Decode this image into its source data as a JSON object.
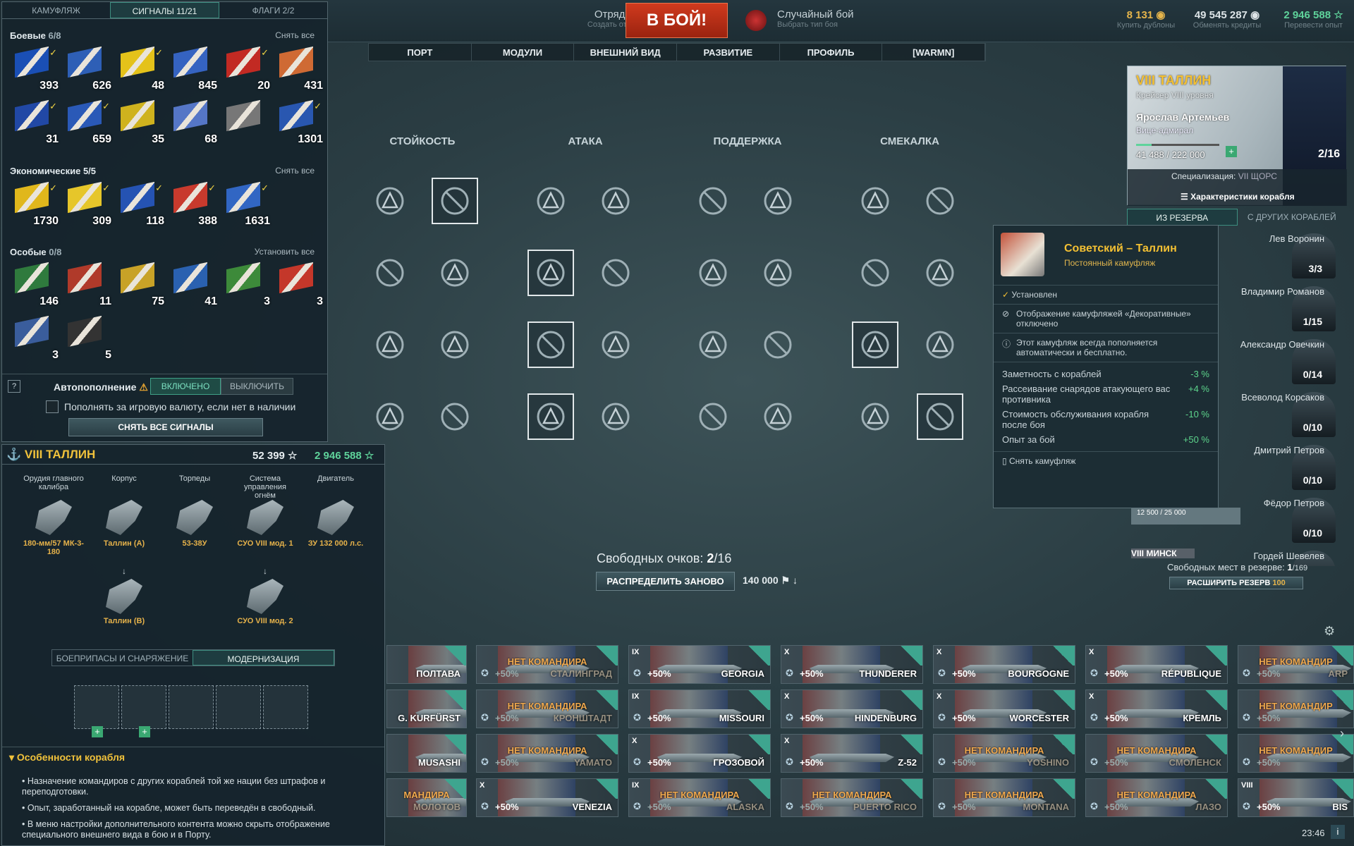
{
  "flags_panel": {
    "tabs": [
      "КАМУФЛЯЖ",
      "СИГНАЛЫ 11/21",
      "ФЛАГИ 2/2"
    ],
    "combat": {
      "title": "Боевые",
      "count": "6/8",
      "action": "Снять все",
      "items": [
        {
          "n": "393",
          "on": true,
          "c": "#1a4fb5"
        },
        {
          "n": "626",
          "on": false,
          "c": "#2e5fb6"
        },
        {
          "n": "48",
          "on": true,
          "c": "#e4c21a"
        },
        {
          "n": "845",
          "on": false,
          "c": "#3563c1"
        },
        {
          "n": "20",
          "on": true,
          "c": "#c22a23"
        },
        {
          "n": "431",
          "on": false,
          "c": "#cf6a34"
        },
        {
          "n": "31",
          "on": true,
          "c": "#2148a5"
        },
        {
          "n": "659",
          "on": true,
          "c": "#2a59b7"
        },
        {
          "n": "35",
          "on": false,
          "c": "#cfb21e"
        },
        {
          "n": "68",
          "on": false,
          "c": "#5576c6"
        },
        {
          "n": "",
          "on": false,
          "c": "#777"
        },
        {
          "n": "1301",
          "on": true,
          "c": "#2957b0"
        }
      ]
    },
    "economic": {
      "title": "Экономические",
      "count": "5/5",
      "action": "Снять все",
      "items": [
        {
          "n": "1730",
          "on": true,
          "c": "#e0b71c"
        },
        {
          "n": "309",
          "on": true,
          "c": "#e6c62a"
        },
        {
          "n": "118",
          "on": true,
          "c": "#2553b3"
        },
        {
          "n": "388",
          "on": true,
          "c": "#c83a2d"
        },
        {
          "n": "1631",
          "on": true,
          "c": "#3166c3"
        }
      ]
    },
    "special": {
      "title": "Особые",
      "count": "0/8",
      "action": "Установить все",
      "items": [
        {
          "n": "146",
          "c": "#2f7a3d"
        },
        {
          "n": "11",
          "c": "#b03a2a"
        },
        {
          "n": "75",
          "c": "#c8a227"
        },
        {
          "n": "41",
          "c": "#2a61b0"
        },
        {
          "n": "3",
          "c": "#3d8a3a"
        },
        {
          "n": "3",
          "c": "#c4372a"
        },
        {
          "n": "3",
          "c": "#3a5d9c"
        },
        {
          "n": "5",
          "c": "#333"
        }
      ]
    },
    "autofill": {
      "label": "Автопополнение",
      "on": "ВКЛЮЧЕНО",
      "off": "ВЫКЛЮЧИТЬ",
      "checkbox": "Пополнять за игровую валюту, если нет в наличии",
      "remove_all": "СНЯТЬ ВСЕ СИГНАЛЫ",
      "help": "?"
    }
  },
  "ship_panel": {
    "title": "VIII ТАЛЛИН",
    "xp": "52 399",
    "free_xp": "2 946 588",
    "modules": [
      {
        "label": "Орудия главного калибра",
        "name": "180-мм/57 МК-3-180"
      },
      {
        "label": "Корпус",
        "name": "Таллин (A)"
      },
      {
        "label": "Торпеды",
        "name": "53-38У"
      },
      {
        "label": "Система управления огнём",
        "name": "СУО VIII мод. 1"
      },
      {
        "label": "Двигатель",
        "name": "ЗУ 132 000 л.с."
      }
    ],
    "upgrades": [
      {
        "name": "Таллин (B)"
      },
      {
        "name": "СУО VIII мод. 2"
      }
    ],
    "tabs": [
      "БОЕПРИПАСЫ И СНАРЯЖЕНИЕ",
      "МОДЕРНИЗАЦИЯ"
    ],
    "features_title": "Особенности корабля",
    "features": [
      "Назначение командиров с других кораблей той же нации без штрафов и переподготовки.",
      "Опыт, заработанный на корабле, может быть переведён в свободный.",
      "В меню настройки дополнительного контента можно скрыть отображение специального внешнего вида в бою и в Порту."
    ]
  },
  "top": {
    "squad": "Отряды",
    "squad_sub": "Создать отряд",
    "battle": "В БОЙ!",
    "mode": "Случайный бой",
    "mode_sub": "Выбрать тип боя",
    "doubloons": "8 131",
    "doubloons_sub": "Купить дублоны",
    "credits": "49 545 287",
    "credits_sub": "Обменять кредиты",
    "freexp": "2 946 588",
    "freexp_sub": "Перевести опыт"
  },
  "nav": [
    "ПОРТ",
    "МОДУЛИ",
    "ВНЕШНИЙ ВИД",
    "РАЗВИТИЕ",
    "ПРОФИЛЬ",
    "[WARMN]"
  ],
  "skills": {
    "columns": [
      "СТОЙКОСТЬ",
      "АТАКА",
      "ПОДДЕРЖКА",
      "СМЕКАЛКА"
    ],
    "free_label": "Свободных очков:",
    "free": "2",
    "total": "/16",
    "reset": "РАСПРЕДЕЛИТЬ ЗАНОВО",
    "reset_cost": "140 000"
  },
  "commander": {
    "ship": "VIII ТАЛЛИН",
    "ship_sub": "Крейсер VIII уровня",
    "name": "Ярослав Артемьев",
    "rank": "Вице-адмирал",
    "xp": "41 488 / 222 000",
    "pts": "2/16",
    "spec_label": "Специализация:",
    "spec": "VII ЩОРС",
    "chars": "Характеристики корабля",
    "tabs": [
      "ИЗ РЕЗЕРВА",
      "С ДРУГИХ КОРАБЛЕЙ"
    ],
    "reserve": [
      {
        "name": "Лев Воронин",
        "pts": "3/3"
      },
      {
        "name": "Владимир Романов",
        "pts": "1/15"
      },
      {
        "name": "Александр Овечкин",
        "pts": "0/14"
      },
      {
        "name": "Всеволод Корсаков",
        "pts": "0/10"
      },
      {
        "name": "Дмитрий Петров",
        "pts": "0/10"
      },
      {
        "name": "Фёдор Петров",
        "pts": "0/10"
      },
      {
        "name": "Гордей Шевелев",
        "pts": ""
      }
    ],
    "minsk": "VIII МИНСК",
    "minsk_xp": "12 500 / 25 000",
    "slots_label": "Свободных мест в резерве:",
    "slots": "1",
    "slots_total": "/169",
    "expand": "РАСШИРИТЬ РЕЗЕРВ",
    "expand_cost": "100"
  },
  "tooltip": {
    "title": "Советский – Таллин",
    "sub": "Постоянный камуфляж",
    "installed": "Установлен",
    "note1": "Отображение камуфляжей «Декоративные» отключено",
    "note2": "Этот камуфляж всегда пополняется автоматически и бесплатно.",
    "stats": [
      {
        "l": "Заметность с кораблей",
        "v": "-3 %"
      },
      {
        "l": "Рассеивание снарядов атакующего вас противника",
        "v": "+4 %"
      },
      {
        "l": "Стоимость обслуживания корабля после боя",
        "v": "-10 %"
      },
      {
        "l": "Опыт за бой",
        "v": "+50 %"
      }
    ],
    "remove": "Снять камуфляж"
  },
  "carousel": {
    "rows": [
      [
        {
          "nc": "",
          "n": "ПОЛТАВА",
          "xp": "",
          "t": ""
        },
        {
          "nc": "НЕТ КОМАНДИРА",
          "n": "СТАЛИНГРАД",
          "xp": "+50%",
          "t": "",
          "dim": true
        },
        {
          "nc": "",
          "n": "GEORGIA",
          "xp": "+50%",
          "t": "IX"
        },
        {
          "nc": "",
          "n": "THUNDERER",
          "xp": "+50%",
          "t": "X"
        },
        {
          "nc": "",
          "n": "BOURGOGNE",
          "xp": "+50%",
          "t": "X"
        },
        {
          "nc": "",
          "n": "RÉPUBLIQUE",
          "xp": "+50%",
          "t": "X"
        },
        {
          "nc": "НЕТ КОМАНДИР",
          "n": "ARP",
          "xp": "+50%",
          "t": "",
          "dim": true
        }
      ],
      [
        {
          "nc": "",
          "n": "G. KURFÜRST",
          "xp": "",
          "t": ""
        },
        {
          "nc": "НЕТ КОМАНДИРА",
          "n": "КРОНШТАДТ",
          "xp": "+50%",
          "t": "",
          "dim": true
        },
        {
          "nc": "",
          "n": "MISSOURI",
          "xp": "+50%",
          "t": "IX"
        },
        {
          "nc": "",
          "n": "HINDENBURG",
          "xp": "+50%",
          "t": "X"
        },
        {
          "nc": "",
          "n": "WORCESTER",
          "xp": "+50%",
          "t": "X"
        },
        {
          "nc": "",
          "n": "КРЕМЛЬ",
          "xp": "+50%",
          "t": "X"
        },
        {
          "nc": "НЕТ КОМАНДИР",
          "n": "",
          "xp": "+50%",
          "t": "",
          "dim": true
        }
      ],
      [
        {
          "nc": "",
          "n": "MUSASHI",
          "xp": "",
          "t": ""
        },
        {
          "nc": "НЕТ КОМАНДИРА",
          "n": "YAMATO",
          "xp": "+50%",
          "t": "",
          "dim": true
        },
        {
          "nc": "",
          "n": "ГРОЗОВОЙ",
          "xp": "+50%",
          "t": "X"
        },
        {
          "nc": "",
          "n": "Z-52",
          "xp": "+50%",
          "t": "X"
        },
        {
          "nc": "НЕТ КОМАНДИРА",
          "n": "YOSHINO",
          "xp": "+50%",
          "t": "",
          "dim": true
        },
        {
          "nc": "НЕТ КОМАНДИРА",
          "n": "СМОЛЕНСК",
          "xp": "+50%",
          "t": "",
          "dim": true
        },
        {
          "nc": "НЕТ КОМАНДИР",
          "n": "",
          "xp": "+50%",
          "t": "",
          "dim": true
        }
      ],
      [
        {
          "nc": "МАНДИРА",
          "n": "МОЛОТОВ",
          "xp": "",
          "t": "",
          "dim": true
        },
        {
          "nc": "",
          "n": "VENEZIA",
          "xp": "+50%",
          "t": "X"
        },
        {
          "nc": "НЕТ КОМАНДИРА",
          "n": "ALASKA",
          "xp": "+50%",
          "t": "IX",
          "dim": true
        },
        {
          "nc": "НЕТ КОМАНДИРА",
          "n": "PUERTO RICO",
          "xp": "+50%",
          "t": "",
          "dim": true
        },
        {
          "nc": "НЕТ КОМАНДИРА",
          "n": "MONTANA",
          "xp": "+50%",
          "t": "",
          "dim": true
        },
        {
          "nc": "НЕТ КОМАНДИРА",
          "n": "ЛАЗО",
          "xp": "+50%",
          "t": "",
          "dim": true
        },
        {
          "nc": "",
          "n": "BIS",
          "xp": "+50%",
          "t": "VIII"
        }
      ]
    ]
  },
  "clock": "23:46"
}
